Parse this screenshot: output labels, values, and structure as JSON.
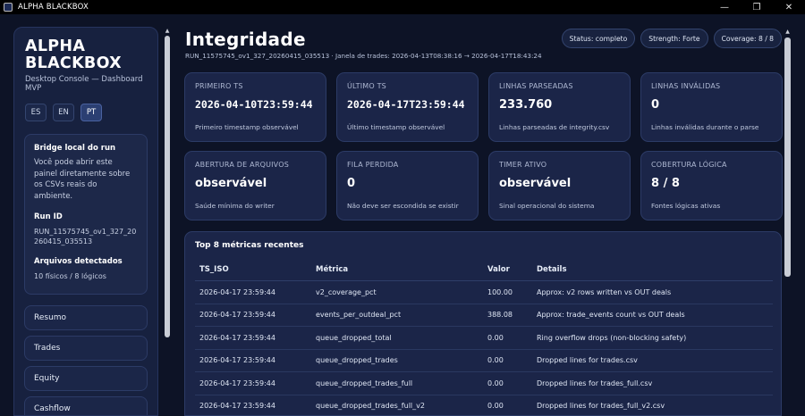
{
  "window": {
    "title": "ALPHA BLACKBOX",
    "minimize": "—",
    "maximize": "❐",
    "close": "✕"
  },
  "sidebar": {
    "brand": "ALPHA BLACKBOX",
    "subtitle": "Desktop Console — Dashboard MVP",
    "languages": [
      "ES",
      "EN",
      "PT"
    ],
    "active_language": "PT",
    "bridge": {
      "title": "Bridge local do run",
      "text": "Você pode abrir este painel diretamente sobre os CSVs reais do ambiente.",
      "run_id_label": "Run ID",
      "run_id": "RUN_11575745_ov1_327_20260415_035513",
      "files_label": "Arquivos detectados",
      "files": "10 físicos / 8 lógicos"
    },
    "nav": [
      "Resumo",
      "Trades",
      "Equity",
      "Cashflow"
    ]
  },
  "header": {
    "title": "Integridade",
    "subtitle": "RUN_11575745_ov1_327_20260415_035513 · Janela de trades: 2026-04-13T08:38:16 → 2026-04-17T18:43:24",
    "pills": [
      "Status: completo",
      "Strength: Forte",
      "Coverage: 8 / 8"
    ]
  },
  "cards": [
    {
      "label": "PRIMEIRO TS",
      "value": "2026-04-10T23:59:44",
      "desc": "Primeiro timestamp observável",
      "style": "mono"
    },
    {
      "label": "ÚLTIMO TS",
      "value": "2026-04-17T23:59:44",
      "desc": "Último timestamp observável",
      "style": "mono"
    },
    {
      "label": "LINHAS PARSEADAS",
      "value": "233.760",
      "desc": "Linhas parseadas de integrity.csv",
      "style": "big"
    },
    {
      "label": "LINHAS INVÁLIDAS",
      "value": "0",
      "desc": "Linhas inválidas durante o parse",
      "style": "big"
    },
    {
      "label": "ABERTURA DE ARQUIVOS",
      "value": "observável",
      "desc": "Saúde mínima do writer",
      "style": "big"
    },
    {
      "label": "FILA PERDIDA",
      "value": "0",
      "desc": "Não deve ser escondida se existir",
      "style": "big"
    },
    {
      "label": "TIMER ATIVO",
      "value": "observável",
      "desc": "Sinal operacional do sistema",
      "style": "big"
    },
    {
      "label": "COBERTURA LÓGICA",
      "value": "8 / 8",
      "desc": "Fontes lógicas ativas",
      "style": "big"
    }
  ],
  "table": {
    "title": "Top 8 métricas recentes",
    "columns": [
      "TS_ISO",
      "Métrica",
      "Valor",
      "Details"
    ],
    "rows": [
      [
        "2026-04-17 23:59:44",
        "v2_coverage_pct",
        "100.00",
        "Approx: v2 rows written vs OUT deals"
      ],
      [
        "2026-04-17 23:59:44",
        "events_per_outdeal_pct",
        "388.08",
        "Approx: trade_events count vs OUT deals"
      ],
      [
        "2026-04-17 23:59:44",
        "queue_dropped_total",
        "0.00",
        "Ring overflow drops (non-blocking safety)"
      ],
      [
        "2026-04-17 23:59:44",
        "queue_dropped_trades",
        "0.00",
        "Dropped lines for trades.csv"
      ],
      [
        "2026-04-17 23:59:44",
        "queue_dropped_trades_full",
        "0.00",
        "Dropped lines for trades_full.csv"
      ],
      [
        "2026-04-17 23:59:44",
        "queue_dropped_trades_full_v2",
        "0.00",
        "Dropped lines for trades_full_v2.csv"
      ]
    ]
  }
}
